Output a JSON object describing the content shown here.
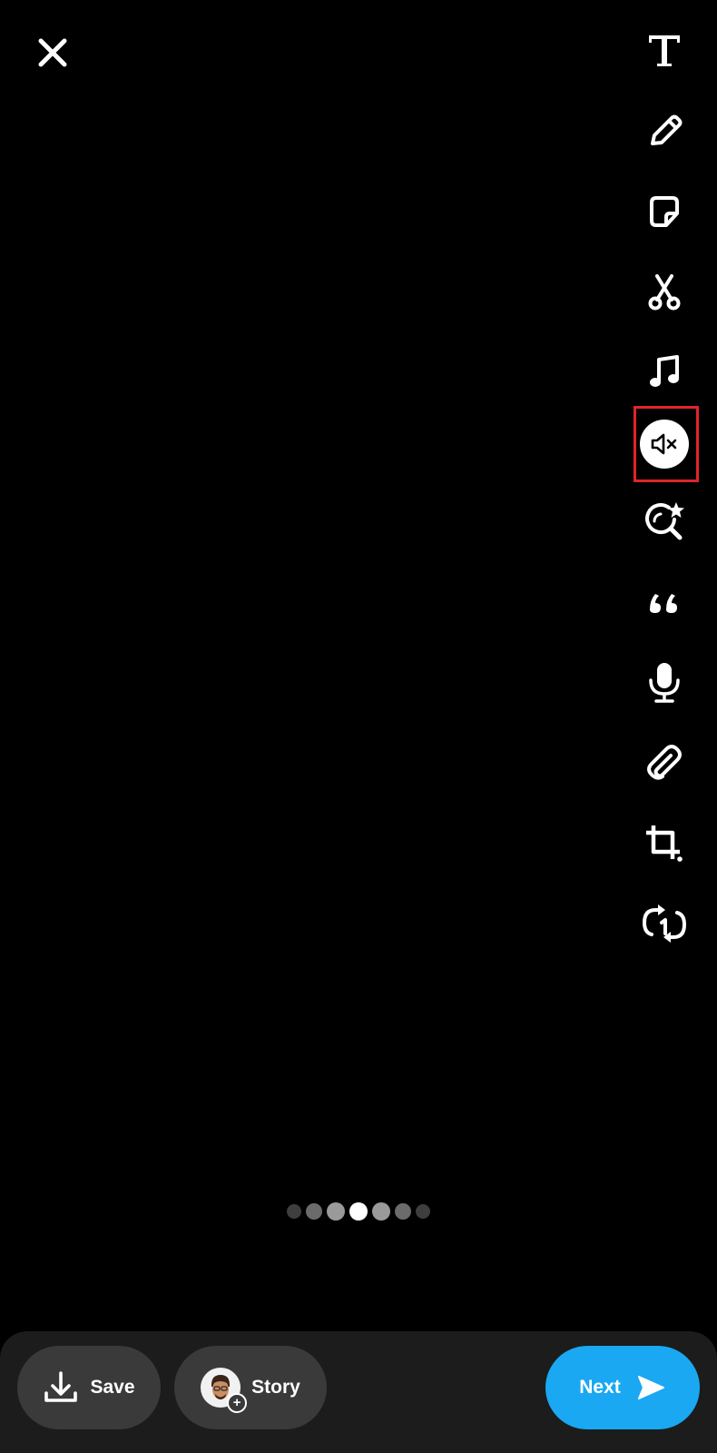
{
  "header": {
    "close_icon": "close-icon"
  },
  "toolbar": {
    "tools": [
      {
        "name": "text-tool",
        "icon": "text-T-icon"
      },
      {
        "name": "draw-tool",
        "icon": "pencil-icon"
      },
      {
        "name": "sticker-tool",
        "icon": "sticker-icon"
      },
      {
        "name": "scissors-tool",
        "icon": "scissors-icon"
      },
      {
        "name": "music-tool",
        "icon": "music-note-icon"
      },
      {
        "name": "mute-tool",
        "icon": "speaker-muted-icon",
        "selected": true
      },
      {
        "name": "lens-search-tool",
        "icon": "lens-sparkle-icon"
      },
      {
        "name": "quote-tool",
        "icon": "quote-icon"
      },
      {
        "name": "voice-tool",
        "icon": "microphone-icon"
      },
      {
        "name": "attachment-tool",
        "icon": "paperclip-icon"
      },
      {
        "name": "crop-tool",
        "icon": "crop-icon"
      },
      {
        "name": "loop-tool",
        "icon": "loop-once-icon"
      }
    ],
    "highlight_color": "#E0242B"
  },
  "page_dots": {
    "count": 7,
    "active_index": 3
  },
  "bottom_bar": {
    "save_label": "Save",
    "story_label": "Story",
    "next_label": "Next",
    "next_color": "#1aa8f2"
  }
}
